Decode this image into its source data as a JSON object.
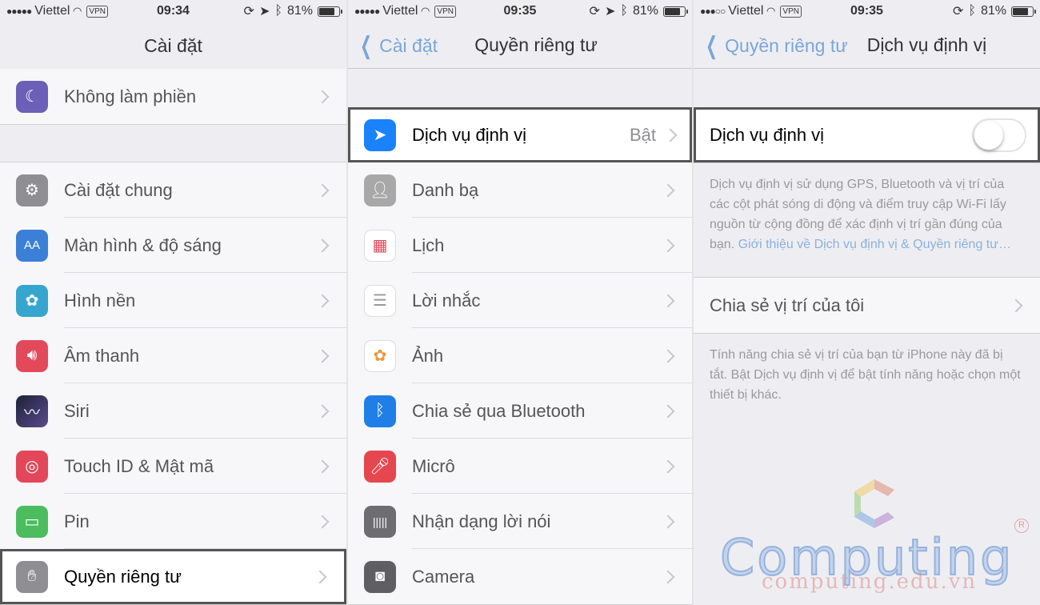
{
  "panel1": {
    "status": {
      "carrier": "Viettel",
      "vpn": "VPN",
      "time": "09:34",
      "battery": "81%"
    },
    "title": "Cài đặt",
    "groups": [
      [
        {
          "label": "Không làm phiền",
          "icon": "moon-icon",
          "color": "#6b5fb8"
        }
      ],
      [
        {
          "label": "Cài đặt chung",
          "icon": "gear-icon",
          "color": "#8e8e93"
        },
        {
          "label": "Màn hình & độ sáng",
          "icon": "display-brightness-icon",
          "color": "#3b7fd6"
        },
        {
          "label": "Hình nền",
          "icon": "flower-wallpaper-icon",
          "color": "#37a6cf"
        },
        {
          "label": "Âm thanh",
          "icon": "speaker-icon",
          "color": "#e24a5c"
        },
        {
          "label": "Siri",
          "icon": "siri-icon",
          "color": "#333a4e"
        },
        {
          "label": "Touch ID & Mật mã",
          "icon": "fingerprint-icon",
          "color": "#e2485a"
        },
        {
          "label": "Pin",
          "icon": "battery-icon",
          "color": "#4bbd5d"
        },
        {
          "label": "Quyền riêng tư",
          "icon": "hand-icon",
          "color": "#8e8e93"
        }
      ]
    ]
  },
  "panel2": {
    "status": {
      "carrier": "Viettel",
      "vpn": "VPN",
      "time": "09:35",
      "battery": "81%"
    },
    "back": "Cài đặt",
    "title": "Quyền riêng tư",
    "location": {
      "label": "Dịch vụ định vị",
      "value": "Bật",
      "icon": "location-arrow-icon",
      "color": "#1a82fb"
    },
    "items": [
      {
        "label": "Danh bạ",
        "icon": "contacts-icon",
        "color": "#9a9a9a"
      },
      {
        "label": "Lịch",
        "icon": "calendar-icon",
        "color": "#ffffff"
      },
      {
        "label": "Lời nhắc",
        "icon": "reminders-icon",
        "color": "#ffffff"
      },
      {
        "label": "Ảnh",
        "icon": "photos-icon",
        "color": "#ffffff"
      },
      {
        "label": "Chia sẻ qua Bluetooth",
        "icon": "bluetooth-icon",
        "color": "#1f7fe6"
      },
      {
        "label": "Micrô",
        "icon": "microphone-icon",
        "color": "#e5474f"
      },
      {
        "label": "Nhận dạng lời nói",
        "icon": "waveform-icon",
        "color": "#6d6d72"
      },
      {
        "label": "Camera",
        "icon": "camera-icon",
        "color": "#5e5e63"
      }
    ]
  },
  "panel3": {
    "status": {
      "carrier": "Viettel",
      "vpn": "VPN",
      "time": "09:35",
      "battery": "81%"
    },
    "back": "Quyền riêng tư",
    "title": "Dịch vụ định vị",
    "toggle_label": "Dịch vụ định vị",
    "toggle_on": false,
    "description": "Dịch vụ định vị sử dụng GPS, Bluetooth và vị trí của các cột phát sóng di động và điểm truy cập Wi-Fi lấy nguồn từ cộng đồng để xác định vị trí gần đúng của bạn.",
    "description_link": "Giới thiệu về Dịch vụ định vị & Quyền riêng tư…",
    "share_label": "Chia sẻ vị trí của tôi",
    "share_note": "Tính năng chia sẻ vị trí của bạn từ iPhone này đã bị tắt. Bật Dịch vụ định vị để bật tính năng hoặc chọn một thiết bị khác."
  },
  "watermark": {
    "brand": "Computing",
    "url": "computing.edu.vn",
    "registered": "R"
  }
}
